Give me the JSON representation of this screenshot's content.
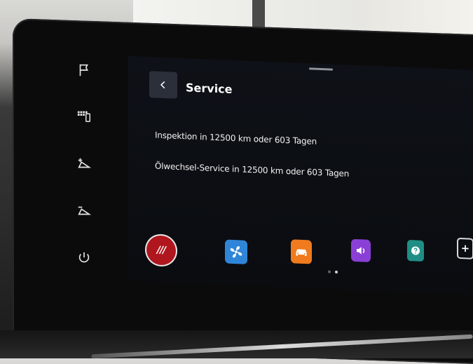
{
  "screen": {
    "title": "Service",
    "messages": [
      "Inspektion in 12500 km oder 603 Tagen",
      "Ölwechsel-Service in 12500 km oder 603 Tagen"
    ]
  },
  "rail": {
    "icons": [
      "flag-icon",
      "phone-keypad-icon",
      "brightness-up-icon",
      "brightness-down-icon",
      "power-icon"
    ]
  },
  "dock": {
    "apps": [
      {
        "icon": "drive-mode-icon",
        "label_glyph": "///",
        "color": "#b0161d"
      },
      {
        "icon": "climate-fan-icon",
        "color": "#2f86d8"
      },
      {
        "icon": "car-icon",
        "color": "#f07a1e"
      },
      {
        "icon": "sound-icon",
        "color": "#8a3fd6"
      },
      {
        "icon": "help-icon",
        "color": "#1f8f86"
      },
      {
        "icon": "plus-icon",
        "color": "#d8d8d8"
      }
    ],
    "page_indicator": {
      "pages": 2,
      "active": 1
    }
  }
}
